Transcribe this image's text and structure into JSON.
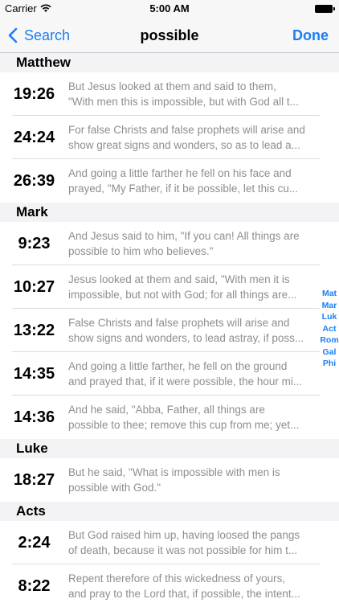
{
  "status": {
    "carrier": "Carrier",
    "time": "5:00 AM"
  },
  "nav": {
    "back_label": "Search",
    "title": "possible",
    "done_label": "Done"
  },
  "colors": {
    "accent": "#1a7ff2",
    "verse_text": "#8e8e93",
    "section_bg": "#f3f3f5"
  },
  "sections": [
    {
      "title": "Matthew",
      "rows": [
        {
          "ref": "19:26",
          "line1": "But Jesus looked at them and said to them,",
          "line2": "\"With men this is impossible, but with God all t..."
        },
        {
          "ref": "24:24",
          "line1": "For false Christs and false prophets will arise and",
          "line2": "show great signs and wonders, so as to lead a..."
        },
        {
          "ref": "26:39",
          "line1": "And going a little farther he fell on his face and",
          "line2": "prayed, \"My Father, if it be possible, let this cu..."
        }
      ]
    },
    {
      "title": "Mark",
      "rows": [
        {
          "ref": "9:23",
          "line1": "And Jesus said to him, \"If you can! All things are",
          "line2": "possible to him who believes.\""
        },
        {
          "ref": "10:27",
          "line1": "Jesus looked at them and said, \"With men it is",
          "line2": "impossible, but not with God; for all things are..."
        },
        {
          "ref": "13:22",
          "line1": "False Christs and false prophets will arise and",
          "line2": "show signs and wonders, to lead astray, if poss..."
        },
        {
          "ref": "14:35",
          "line1": "And going a little farther, he fell on the ground",
          "line2": "and prayed that, if it were possible, the hour mi..."
        },
        {
          "ref": "14:36",
          "line1": "And he said, \"Abba, Father, all things are",
          "line2": "possible to thee; remove this cup from me; yet..."
        }
      ]
    },
    {
      "title": "Luke",
      "rows": [
        {
          "ref": "18:27",
          "line1": "But he said, \"What is impossible with men is",
          "line2": "possible with God.\""
        }
      ]
    },
    {
      "title": "Acts",
      "rows": [
        {
          "ref": "2:24",
          "line1": "But God raised him up, having loosed the pangs",
          "line2": "of death, because it was not possible for him t..."
        },
        {
          "ref": "8:22",
          "line1": "Repent therefore of this wickedness of yours,",
          "line2": "and pray to the Lord that, if possible, the intent..."
        }
      ]
    }
  ],
  "index_items": [
    "Mat",
    "Mar",
    "Luk",
    "Act",
    "Rom",
    "Gal",
    "Phi"
  ]
}
